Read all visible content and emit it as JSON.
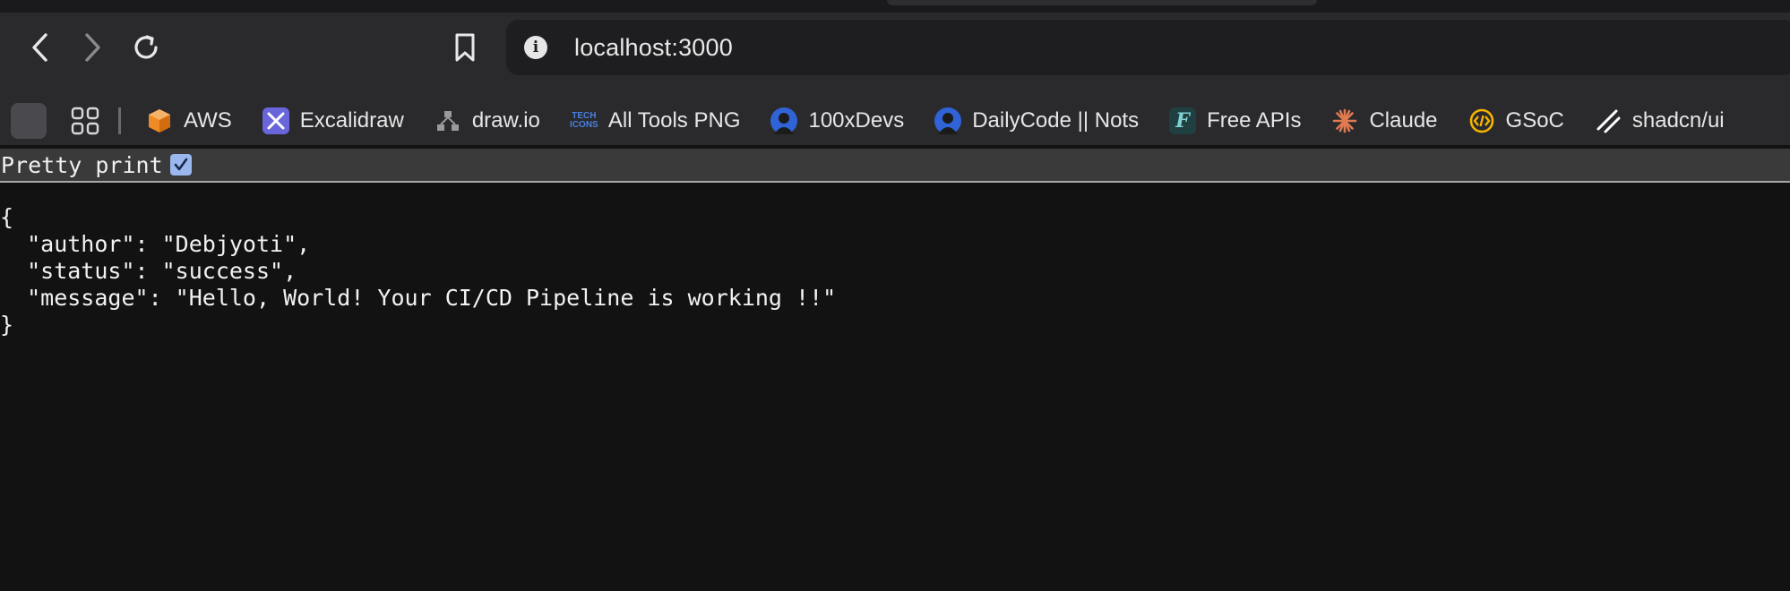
{
  "browser": {
    "url": "localhost:3000",
    "nav": {
      "back": "back-arrow-icon",
      "forward": "forward-arrow-icon",
      "reload": "reload-icon",
      "bookmark": "bookmark-icon",
      "site_info": "info-icon"
    },
    "bookmarks": [
      {
        "label": "AWS",
        "icon": "aws-cube-icon",
        "color": "#f08a24"
      },
      {
        "label": "Excalidraw",
        "icon": "excalidraw-icon",
        "color": "#6965db"
      },
      {
        "label": "draw.io",
        "icon": "drawio-icon",
        "color": "#9a9a9a"
      },
      {
        "label": "All Tools PNG",
        "icon": "tech-icons-icon",
        "color": "#3a6fd8"
      },
      {
        "label": "100xDevs",
        "icon": "avatar-icon",
        "color": "#2f63d6"
      },
      {
        "label": "DailyCode || Nots",
        "icon": "avatar-icon",
        "color": "#2f63d6"
      },
      {
        "label": "Free APIs",
        "icon": "free-apis-icon",
        "color": "#2d6f72"
      },
      {
        "label": "Claude",
        "icon": "claude-sparkle-icon",
        "color": "#e07a4f"
      },
      {
        "label": "GSoC",
        "icon": "gsoc-code-icon",
        "color": "#f4b400"
      },
      {
        "label": "shadcn/ui",
        "icon": "shadcn-icon",
        "color": "#ffffff"
      }
    ]
  },
  "page": {
    "pretty_print_label": "Pretty print",
    "pretty_print_checked": true,
    "json_open": "{",
    "json_lines": [
      "  \"author\": \"Debjyoti\",",
      "  \"status\": \"success\",",
      "  \"message\": \"Hello, World! Your CI/CD Pipeline is working !!\""
    ],
    "json_close": "}"
  }
}
